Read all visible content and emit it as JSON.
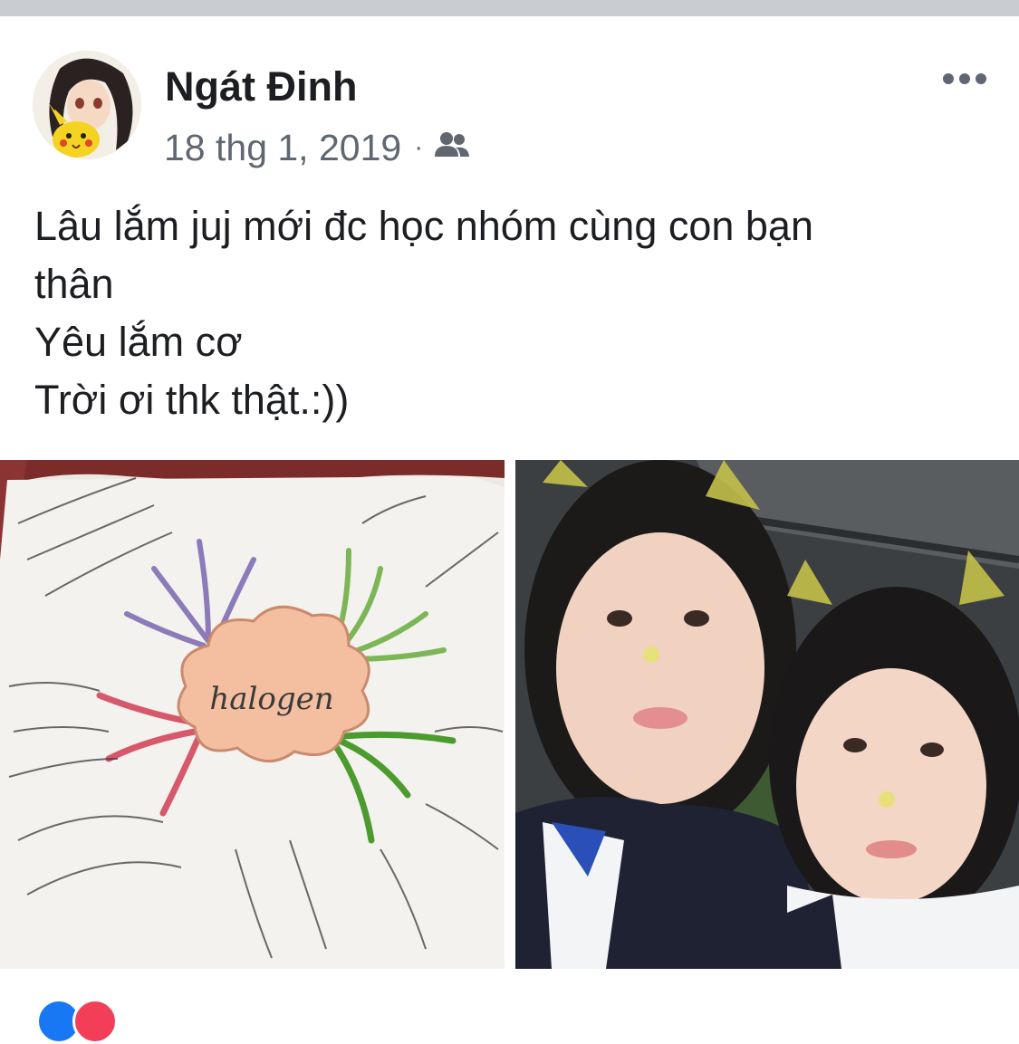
{
  "post": {
    "author": "Ngát Đinh",
    "date": "18 thg 1, 2019",
    "separator": "·",
    "audience_icon": "friends-icon",
    "more_icon": "more-options-icon",
    "caption": [
      "Lâu lắm juj mới đc học nhóm cùng con bạn",
      "thân",
      "Yêu lắm cơ",
      "Trời ơi thk thật.:))"
    ],
    "mindmap": {
      "center_label": "halogen"
    }
  },
  "colors": {
    "author_text": "#1c1e21",
    "meta_text": "#606770",
    "top_strip": "#c9ccd1",
    "like_blue": "#1877f2",
    "love_red": "#f33e58"
  }
}
